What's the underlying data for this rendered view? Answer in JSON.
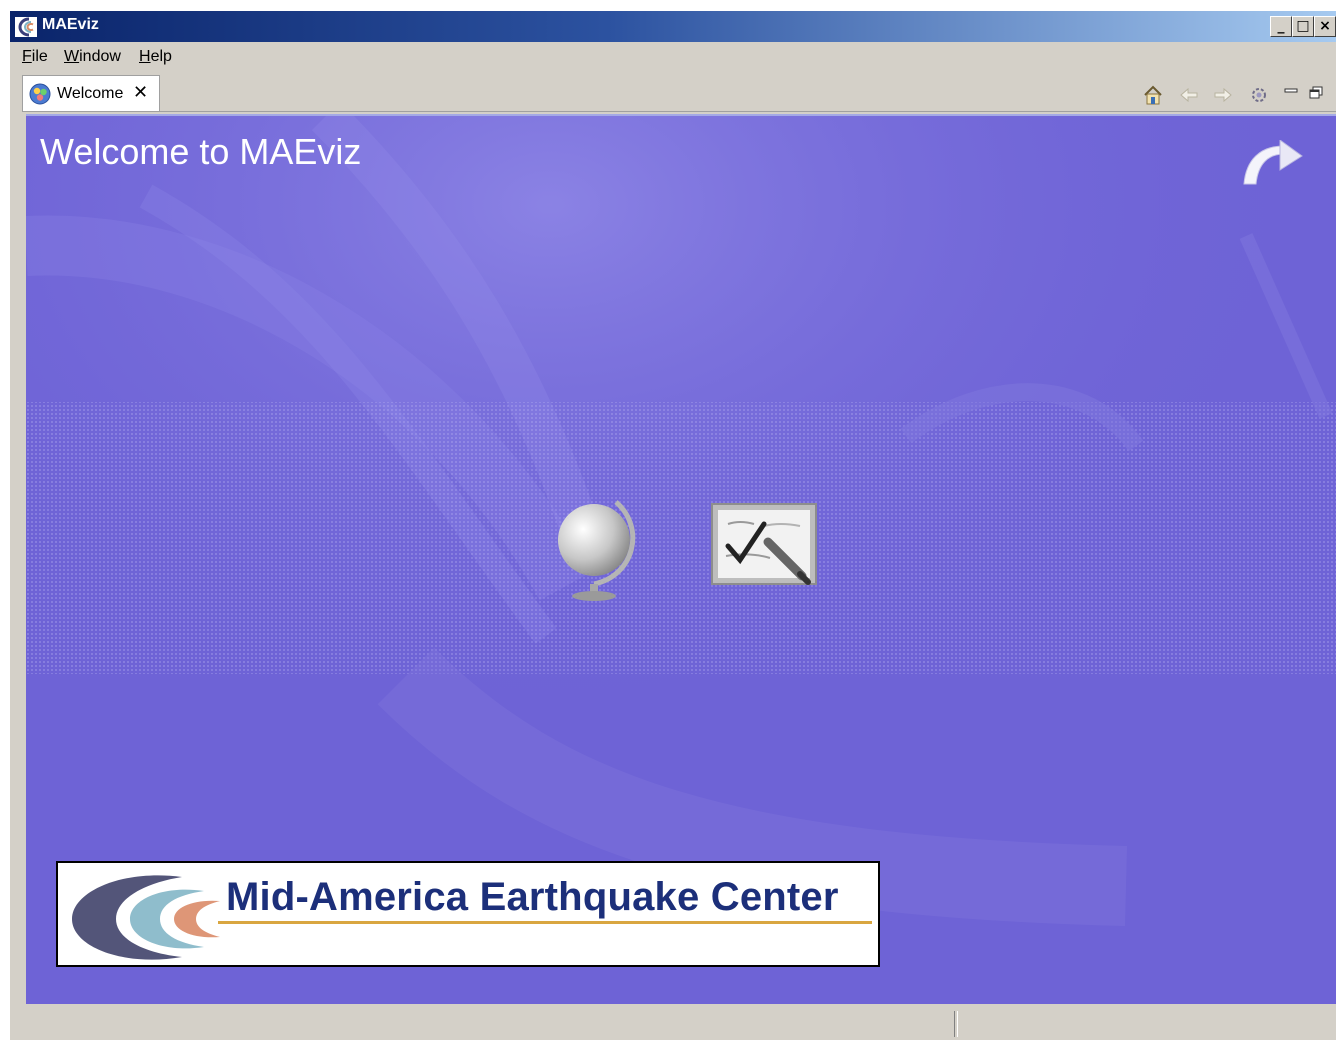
{
  "window": {
    "title": "MAEviz",
    "buttons": {
      "minimize": "_",
      "maximize": "□",
      "close": "×"
    }
  },
  "menu": {
    "items": [
      "File",
      "Window",
      "Help"
    ]
  },
  "tab": {
    "label": "Welcome",
    "close": "✕"
  },
  "toolbar": {
    "icons": [
      "home-icon",
      "back-arrow-icon",
      "forward-arrow-icon",
      "customize-icon",
      "minimize-view-icon",
      "maximize-view-icon"
    ]
  },
  "welcome": {
    "title": "Welcome to MAEviz",
    "links": [
      "globe-icon",
      "tutorial-checklist-icon",
      "workbench-arrow-icon"
    ]
  },
  "logo": {
    "text": "Mid-America Earthquake Center"
  },
  "colors": {
    "title_bar": "#0a246a",
    "welcome_bg": "#6e63d6",
    "logo_text": "#1c2f7a",
    "logo_underline": "#d9a640"
  }
}
